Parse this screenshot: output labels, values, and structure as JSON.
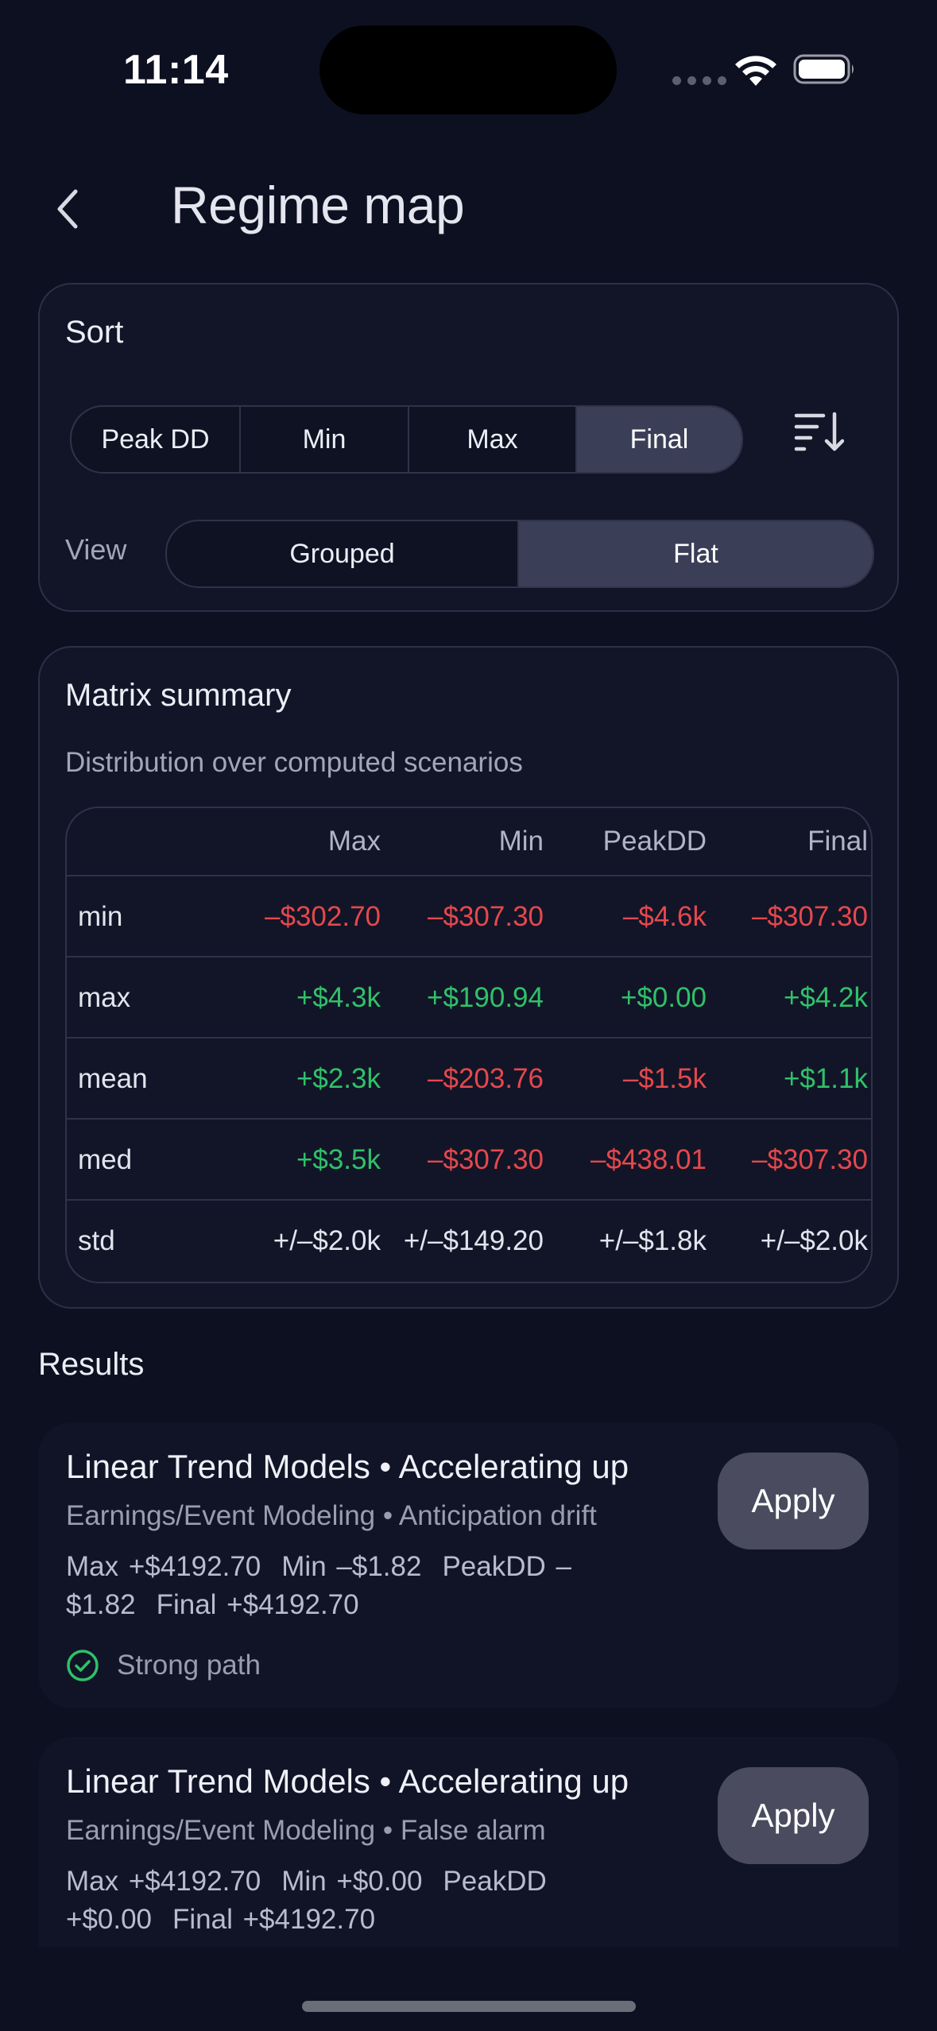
{
  "status_bar": {
    "time": "11:14"
  },
  "nav": {
    "title": "Regime map",
    "back_icon": "chevron-left-icon"
  },
  "sort_card": {
    "title": "Sort",
    "sort_options": [
      "Peak DD",
      "Min",
      "Max",
      "Final"
    ],
    "selected_sort": "Final",
    "sort_order_icon": "sort-descending-icon",
    "view_label": "View",
    "view_options": [
      "Grouped",
      "Flat"
    ],
    "selected_view": "Flat"
  },
  "matrix_summary": {
    "title": "Matrix summary",
    "subtitle": "Distribution over computed scenarios",
    "columns": [
      "Max",
      "Min",
      "PeakDD",
      "Final"
    ],
    "rows": [
      {
        "label": "min",
        "cells": [
          "–$302.70",
          "–$307.30",
          "–$4.6k",
          "–$307.30"
        ],
        "tones": [
          "neg",
          "neg",
          "neg",
          "neg"
        ]
      },
      {
        "label": "max",
        "cells": [
          "+$4.3k",
          "+$190.94",
          "+$0.00",
          "+$4.2k"
        ],
        "tones": [
          "pos",
          "pos",
          "pos",
          "pos"
        ]
      },
      {
        "label": "mean",
        "cells": [
          "+$2.3k",
          "–$203.76",
          "–$1.5k",
          "+$1.1k"
        ],
        "tones": [
          "pos",
          "neg",
          "neg",
          "pos"
        ]
      },
      {
        "label": "med",
        "cells": [
          "+$3.5k",
          "–$307.30",
          "–$438.01",
          "–$307.30"
        ],
        "tones": [
          "pos",
          "neg",
          "neg",
          "neg"
        ]
      },
      {
        "label": "std",
        "cells": [
          "+/–$2.0k",
          "+/–$149.20",
          "+/–$1.8k",
          "+/–$2.0k"
        ],
        "tones": [
          "neu",
          "neu",
          "neu",
          "neu"
        ]
      }
    ]
  },
  "results": {
    "heading": "Results",
    "items": [
      {
        "title": "Linear Trend Models • Accelerating up",
        "subtitle": "Earnings/Event Modeling • Anticipation drift",
        "stats": [
          "Max +$4192.70",
          "Min –$1.82",
          "PeakDD –$1.82",
          "Final +$4192.70"
        ],
        "apply_label": "Apply",
        "status_icon": "check-circle-icon",
        "status_text": "Strong path"
      },
      {
        "title": "Linear Trend Models • Accelerating up",
        "subtitle": "Earnings/Event Modeling • False alarm",
        "stats": [
          "Max +$4192.70",
          "Min +$0.00",
          "PeakDD +$0.00",
          "Final +$4192.70"
        ],
        "apply_label": "Apply"
      }
    ]
  },
  "colors": {
    "background": "#0d1020",
    "card": "#121527",
    "negative": "#e5484d",
    "positive": "#30c16a",
    "active_segment": "#3b3e57",
    "apply_button": "#4a4b5e"
  }
}
